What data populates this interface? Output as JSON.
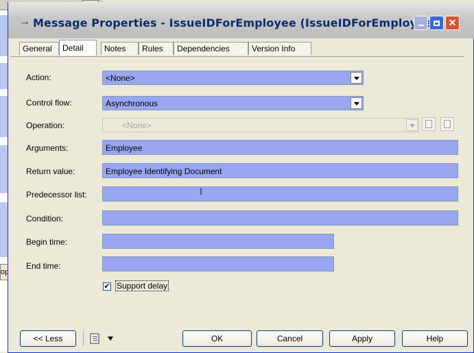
{
  "window": {
    "title": "Message Properties - IssueIDForEmployee (IssueIDForEmployee)"
  },
  "tabs": [
    "General",
    "Detail",
    "Notes",
    "Rules",
    "Dependencies",
    "Version Info"
  ],
  "active_tab": "Detail",
  "form": {
    "action": {
      "label": "Action:",
      "value": "<None>"
    },
    "control_flow": {
      "label": "Control flow:",
      "value": "Asynchronous"
    },
    "operation": {
      "label": "Operation:",
      "value": "<None>"
    },
    "arguments": {
      "label": "Arguments:",
      "value": "Employee"
    },
    "return_value": {
      "label": "Return value:",
      "value": "Employee Identifying Document"
    },
    "predecessor_list": {
      "label": "Predecessor list:",
      "value": ""
    },
    "condition": {
      "label": "Condition:",
      "value": ""
    },
    "begin_time": {
      "label": "Begin time:",
      "value": ""
    },
    "end_time": {
      "label": "End time:",
      "value": ""
    },
    "support_delay": {
      "label": "Support delay",
      "checked": true
    }
  },
  "buttons": {
    "less": "<< Less",
    "ok": "OK",
    "cancel": "Cancel",
    "apply": "Apply",
    "help": "Help"
  },
  "colors": {
    "field_fill": "#9aa6f0",
    "dialog_bg": "#ece9d8",
    "title_text": "#0d2b6b"
  },
  "background_stub": "op"
}
